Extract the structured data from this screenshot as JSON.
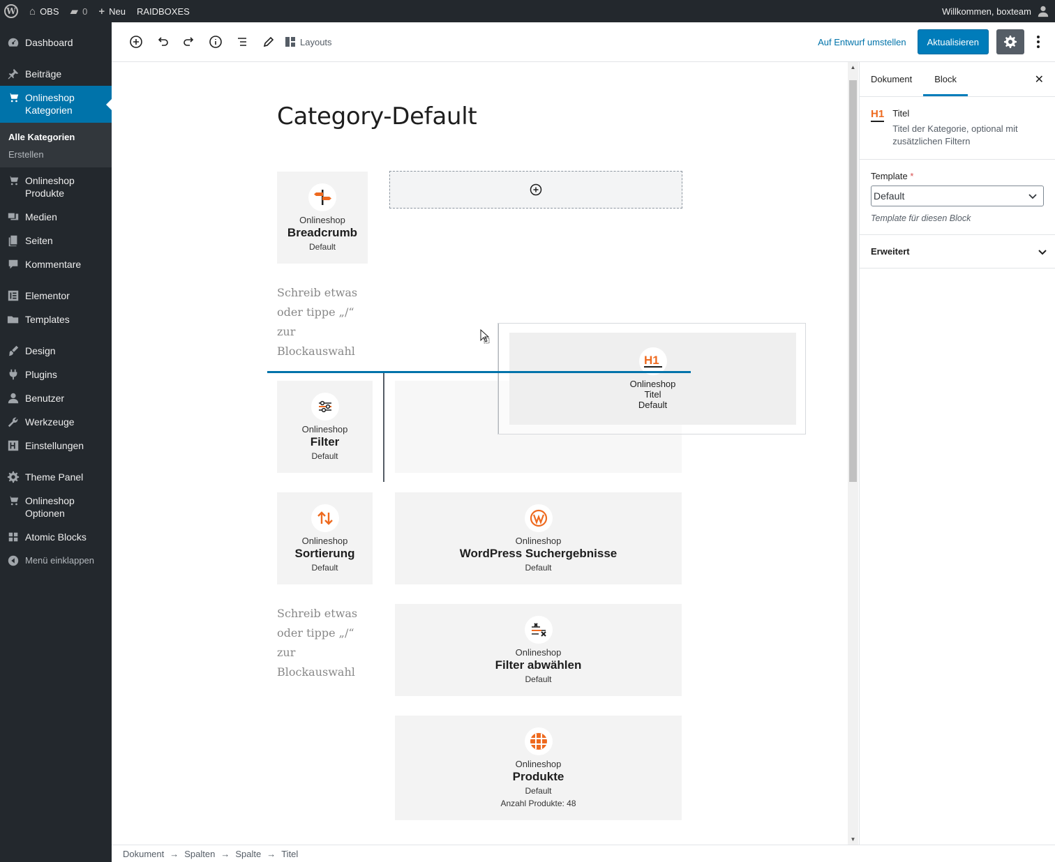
{
  "adminbar": {
    "site_name": "OBS",
    "comments_count": "0",
    "new_label": "Neu",
    "raidboxes_label": "RAIDBOXES",
    "greeting": "Willkommen, boxteam"
  },
  "sidebar": {
    "items": [
      {
        "label": "Dashboard"
      },
      {
        "label": "Beiträge"
      },
      {
        "label": "Onlineshop Kategorien"
      },
      {
        "label": "Onlineshop Produkte"
      },
      {
        "label": "Medien"
      },
      {
        "label": "Seiten"
      },
      {
        "label": "Kommentare"
      },
      {
        "label": "Elementor"
      },
      {
        "label": "Templates"
      },
      {
        "label": "Design"
      },
      {
        "label": "Plugins"
      },
      {
        "label": "Benutzer"
      },
      {
        "label": "Werkzeuge"
      },
      {
        "label": "Einstellungen"
      },
      {
        "label": "Theme Panel"
      },
      {
        "label": "Onlineshop Optionen"
      },
      {
        "label": "Atomic Blocks"
      },
      {
        "label": "Menü einklappen"
      }
    ],
    "submenu": {
      "current": "Alle Kategorien",
      "other": "Erstellen"
    }
  },
  "toolbar": {
    "layouts_label": "Layouts",
    "draft_label": "Auf Entwurf umstellen",
    "update_label": "Aktualisieren"
  },
  "editor": {
    "title": "Category-Default",
    "placeholder_1": "Schreib etwas oder tippe „/“ zur Blockauswahl",
    "placeholder_2": "Schreib etwas oder tippe „/“ zur Blockauswahl",
    "blocks": {
      "breadcrumb": {
        "kicker": "Onlineshop",
        "name": "Breadcrumb",
        "sub": "Default"
      },
      "filter": {
        "kicker": "Onlineshop",
        "name": "Filter",
        "sub": "Default"
      },
      "sortierung": {
        "kicker": "Onlineshop",
        "name": "Sortierung",
        "sub": "Default"
      },
      "suche": {
        "kicker": "Onlineshop",
        "name": "WordPress Suchergebnisse",
        "sub": "Default"
      },
      "filter_abwaehlen": {
        "kicker": "Onlineshop",
        "name": "Filter abwählen",
        "sub": "Default"
      },
      "produkte": {
        "kicker": "Onlineshop",
        "name": "Produkte",
        "sub": "Default",
        "extra": "Anzahl Produkte: 48"
      },
      "titel": {
        "kicker": "Onlineshop",
        "name": "Titel",
        "sub": "Default"
      }
    }
  },
  "footer": {
    "crumbs": [
      "Dokument",
      "Spalten",
      "Spalte",
      "Titel"
    ]
  },
  "settings": {
    "tab_document": "Dokument",
    "tab_block": "Block",
    "block_title": "Titel",
    "block_desc": "Titel der Kategorie, optional mit zusätzlichen Filtern",
    "template_label": "Template",
    "template_required": "*",
    "template_value": "Default",
    "template_help": "Template für diesen Block",
    "advanced_label": "Erweitert"
  },
  "colors": {
    "accent": "#0073aa",
    "brand_orange": "#ee6a1f",
    "admin_dark": "#23282d"
  }
}
